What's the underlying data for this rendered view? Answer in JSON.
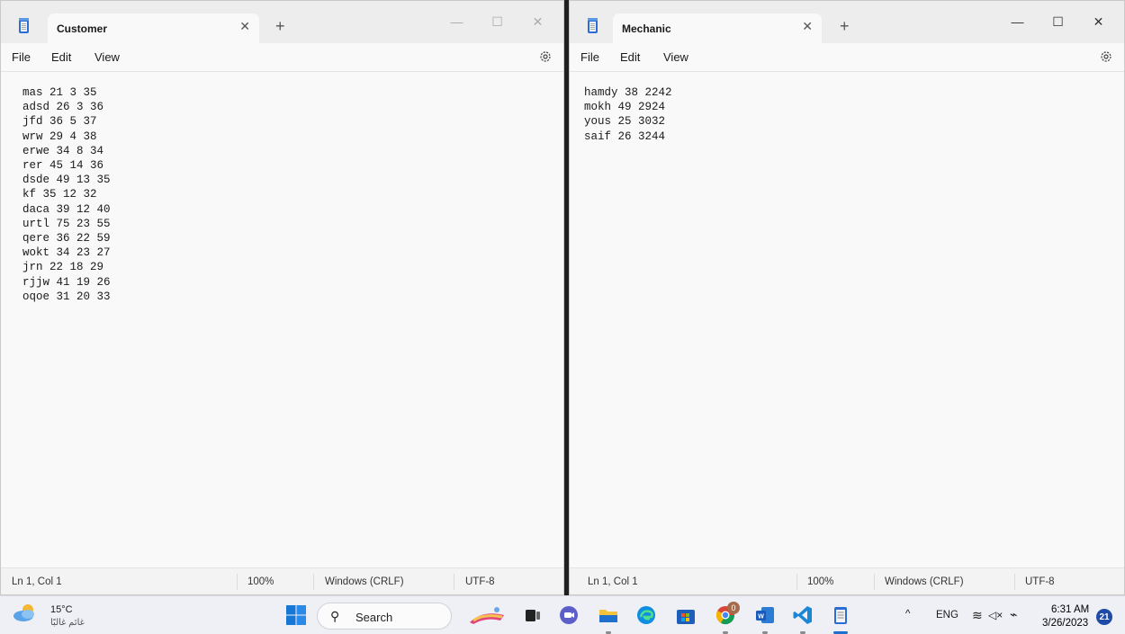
{
  "left_window": {
    "tab_title": "Customer",
    "menu": {
      "file": "File",
      "edit": "Edit",
      "view": "View"
    },
    "content": "mas 21 3 35\nadsd 26 3 36\njfd 36 5 37\nwrw 29 4 38\nerwe 34 8 34\nrer 45 14 36\ndsde 49 13 35\nkf 35 12 32\ndaca 39 12 40\nurtl 75 23 55\nqere 36 22 59\nwokt 34 23 27\njrn 22 18 29\nrjjw 41 19 26\noqoe 31 20 33",
    "status": {
      "position": "Ln 1, Col 1",
      "zoom": "100%",
      "line_ending": "Windows (CRLF)",
      "encoding": "UTF-8"
    }
  },
  "right_window": {
    "tab_title": "Mechanic",
    "menu": {
      "file": "File",
      "edit": "Edit",
      "view": "View"
    },
    "content": "hamdy 38 2242\nmokh 49 2924\nyous 25 3032\nsaif 26 3244",
    "status": {
      "position": "Ln 1, Col 1",
      "zoom": "100%",
      "line_ending": "Windows (CRLF)",
      "encoding": "UTF-8"
    }
  },
  "glyphs": {
    "close": "✕",
    "plus": "+",
    "minimize": "—",
    "maximize": "☐",
    "search": "⚲",
    "chevron_up": "^",
    "wifi": "≋",
    "volume": "◁×",
    "battery": "⌁"
  },
  "taskbar": {
    "weather": {
      "temp": "15°C",
      "desc": "غائم غالبًا"
    },
    "search_label": "Search",
    "chrome_badge": "0",
    "language": "ENG",
    "time": "6:31 AM",
    "date": "3/26/2023",
    "notifications": "21"
  },
  "colors": {
    "accent": "#2a6dd6",
    "taskbar": "#eef0f6",
    "window_bg": "#f9f9f9"
  }
}
